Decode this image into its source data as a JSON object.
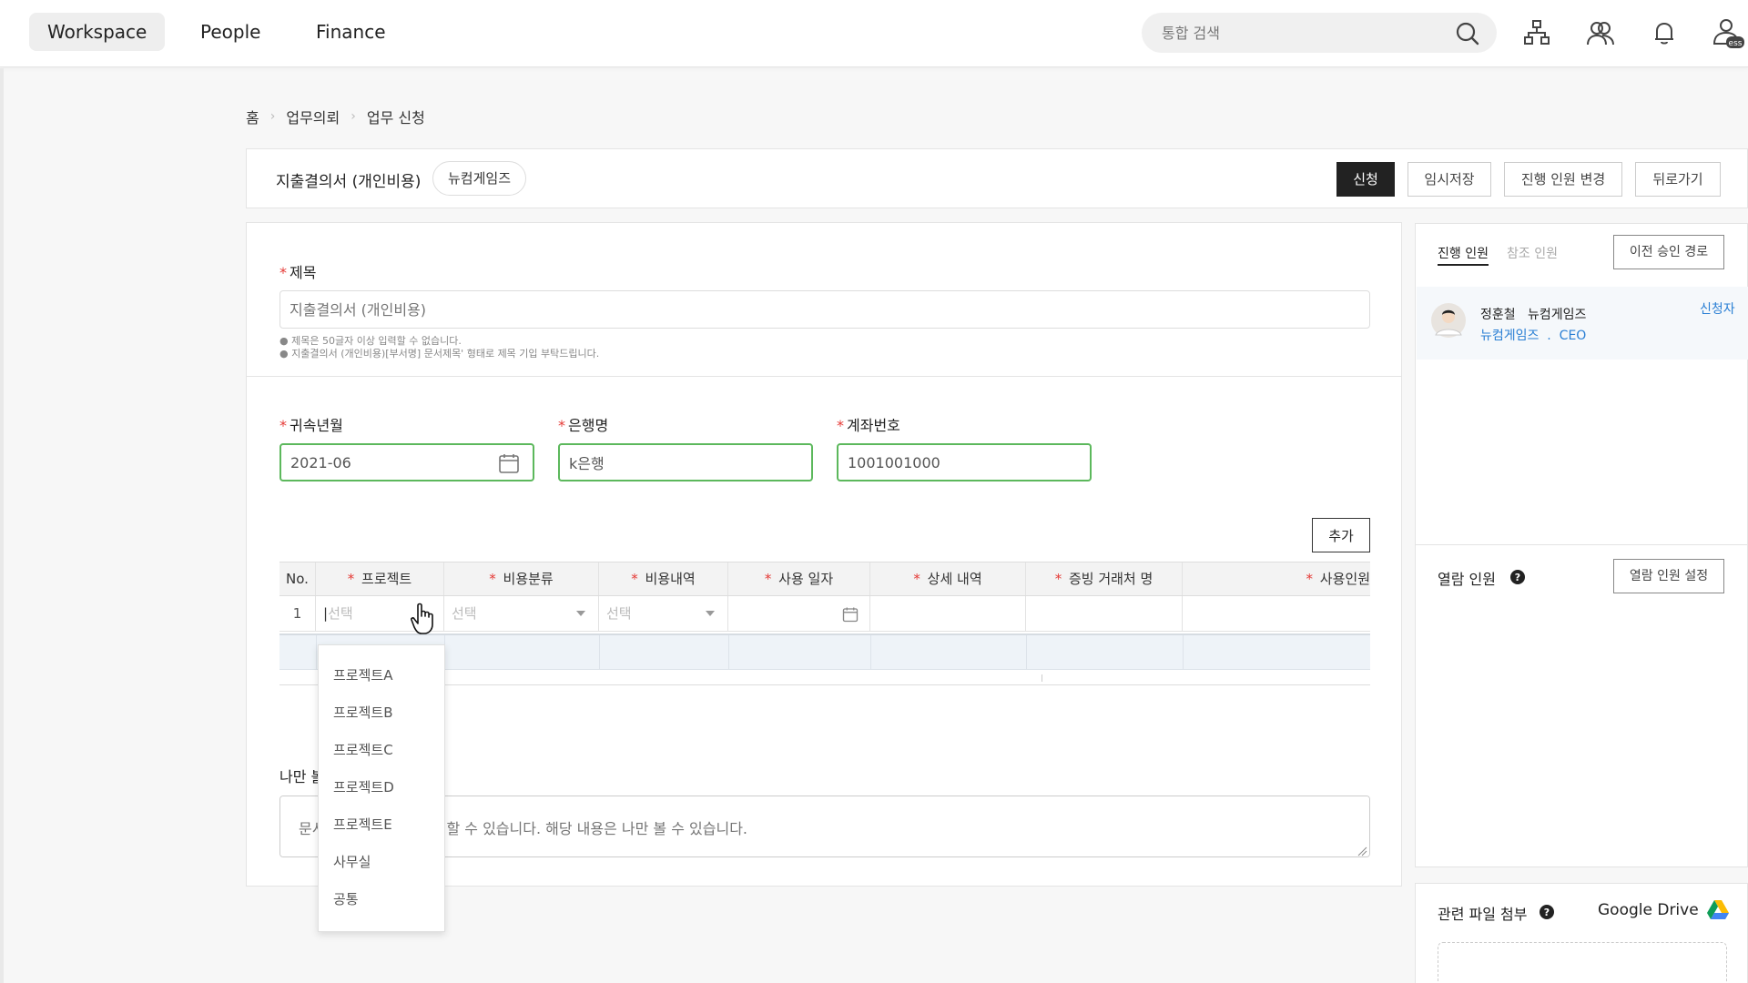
{
  "topnav": {
    "tabs": [
      {
        "label": "Workspace"
      },
      {
        "label": "People"
      },
      {
        "label": "Finance"
      }
    ],
    "search_placeholder": "통합 검색"
  },
  "breadcrumb": [
    "홈",
    "업무의뢰",
    "업무 신청"
  ],
  "header": {
    "doc_title": "지출결의서 (개인비용)",
    "company": "뉴컴게임즈",
    "buttons": {
      "submit": "신청",
      "save_draft": "임시저장",
      "change_approvers": "진행 인원 변경",
      "back": "뒤로가기"
    }
  },
  "form": {
    "title_label": "제목",
    "title_placeholder": "지출결의서 (개인비용)",
    "hint_1": "제목은 50글자 이상 입력할 수 없습니다.",
    "hint_2": "지출결의서 (개인비용)[부서명] 문서제목' 형태로 제목 기입 부탁드립니다.",
    "period_label": "귀속년월",
    "period_value": "2021-06",
    "bank_label": "은행명",
    "bank_value": "k은행",
    "account_label": "계좌번호",
    "account_value": "1001001000",
    "add_label": "추가",
    "table": {
      "columns": [
        "No.",
        "프로젝트",
        "비용분류",
        "비용내역",
        "사용 일자",
        "상세 내역",
        "증빙 거래처 명",
        "사용인원"
      ],
      "rows": [
        {
          "no": "1",
          "project": "선택",
          "category": "선택",
          "detail": "선택"
        }
      ]
    },
    "memo_label": "나만 볼",
    "memo_placeholder": "문서에 관한 메모를 기입할 수 있습니다. 해당 내용은 나만 볼 수 있습니다."
  },
  "project_dropdown": {
    "options": [
      "프로젝트A",
      "프로젝트B",
      "프로젝트C",
      "프로젝트D",
      "프로젝트E",
      "사무실",
      "공통"
    ]
  },
  "sidebar": {
    "tab_active": "진행 인원",
    "tab_inactive": "참조 인원",
    "prev_route_button": "이전 승인 경로",
    "approver": {
      "name": "정훈철",
      "company": "뉴컴게임즈",
      "dept": "뉴컴게임즈",
      "position": "CEO",
      "role": "신청자"
    },
    "viewer_title": "열람 인원",
    "viewer_button": "열람 인원 설정"
  },
  "files": {
    "title": "관련 파일 첨부",
    "drive_label": "Google Drive"
  },
  "colors": {
    "accent_blue": "#2a7fd4",
    "required_red": "#e53935",
    "input_green": "#5cb85c",
    "primary_dark": "#222222"
  }
}
